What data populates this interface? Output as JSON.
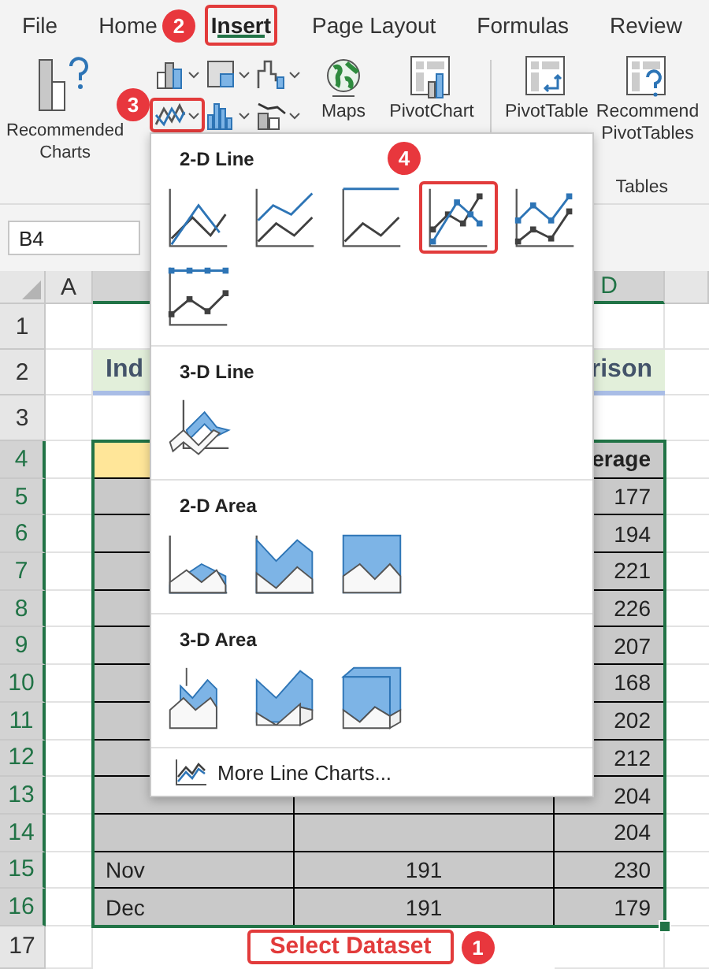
{
  "ribbon_tabs": [
    {
      "label": "File",
      "selected": false,
      "highlighted": false
    },
    {
      "label": "Home",
      "selected": false,
      "highlighted": false
    },
    {
      "label": "Insert",
      "selected": true,
      "highlighted": true
    },
    {
      "label": "Page Layout",
      "selected": false,
      "highlighted": false
    },
    {
      "label": "Formulas",
      "selected": false,
      "highlighted": false
    },
    {
      "label": "Review",
      "selected": false,
      "highlighted": false
    }
  ],
  "ribbon": {
    "recommended_charts": [
      "Recommended",
      "Charts"
    ],
    "chart_buttons": [
      {
        "kind": "column",
        "highlighted": false
      },
      {
        "kind": "hierarchy",
        "highlighted": false
      },
      {
        "kind": "waterfall",
        "highlighted": false
      },
      {
        "kind": "line",
        "highlighted": true
      },
      {
        "kind": "statistic",
        "highlighted": false
      },
      {
        "kind": "combo",
        "highlighted": false
      }
    ],
    "maps": "Maps",
    "pivot_chart": "PivotChart",
    "pivot_table": "PivotTable",
    "recommended_pivot_tables": [
      "Recommend",
      "PivotTables"
    ],
    "group_label": "Tables"
  },
  "name_box": "B4",
  "columns": [
    {
      "label": "A",
      "selected": false
    },
    {
      "selected": true
    },
    {
      "label": "D",
      "selected": true
    }
  ],
  "rows": [
    {
      "number": "1",
      "selected": false,
      "kind": "blank"
    },
    {
      "number": "2",
      "selected": false,
      "kind": "title",
      "b": "Ind",
      "d": "rison"
    },
    {
      "number": "3",
      "selected": false,
      "kind": "blank"
    },
    {
      "number": "4",
      "selected": true,
      "kind": "header",
      "d": "erage"
    },
    {
      "number": "5",
      "selected": true,
      "kind": "data",
      "d": "177"
    },
    {
      "number": "6",
      "selected": true,
      "kind": "data",
      "d": "194"
    },
    {
      "number": "7",
      "selected": true,
      "kind": "data",
      "d": "221"
    },
    {
      "number": "8",
      "selected": true,
      "kind": "data",
      "d": "226"
    },
    {
      "number": "9",
      "selected": true,
      "kind": "data",
      "d": "207"
    },
    {
      "number": "10",
      "selected": true,
      "kind": "data",
      "d": "168"
    },
    {
      "number": "11",
      "selected": true,
      "kind": "data",
      "d": "202"
    },
    {
      "number": "12",
      "selected": true,
      "kind": "data",
      "d": "212"
    },
    {
      "number": "13",
      "selected": true,
      "kind": "data",
      "d": "204"
    },
    {
      "number": "14",
      "selected": true,
      "kind": "data",
      "d": "204"
    },
    {
      "number": "15",
      "selected": true,
      "kind": "data",
      "b": "Nov",
      "c": "191",
      "d": "230"
    },
    {
      "number": "16",
      "selected": true,
      "kind": "data",
      "b": "Dec",
      "c": "191",
      "d": "179"
    },
    {
      "number": "17",
      "selected": false,
      "kind": "blank"
    }
  ],
  "chart_menu": {
    "sections": [
      {
        "title": "2-D Line",
        "options": [
          {
            "kind": "line",
            "highlighted": false
          },
          {
            "kind": "stacked_line",
            "highlighted": false
          },
          {
            "kind": "stacked100_line",
            "highlighted": false
          },
          {
            "kind": "line_markers",
            "highlighted": true
          },
          {
            "kind": "stacked_line_markers",
            "highlighted": false
          },
          {
            "kind": "stacked100_line_markers",
            "highlighted": false
          }
        ]
      },
      {
        "title": "3-D Line",
        "options": [
          {
            "kind": "line3d",
            "highlighted": false
          }
        ]
      },
      {
        "title": "2-D Area",
        "options": [
          {
            "kind": "area",
            "highlighted": false
          },
          {
            "kind": "stacked_area",
            "highlighted": false
          },
          {
            "kind": "stacked100_area",
            "highlighted": false
          }
        ]
      },
      {
        "title": "3-D Area",
        "options": [
          {
            "kind": "area3d",
            "highlighted": false
          },
          {
            "kind": "stacked_area3d",
            "highlighted": false
          },
          {
            "kind": "stacked100_area3d",
            "highlighted": false
          }
        ]
      }
    ],
    "more_link": "More Line Charts..."
  },
  "step_badges": {
    "dataset": "1",
    "insert_tab": "2",
    "line_button": "3",
    "chart_option": "4"
  },
  "callout": "Select Dataset"
}
